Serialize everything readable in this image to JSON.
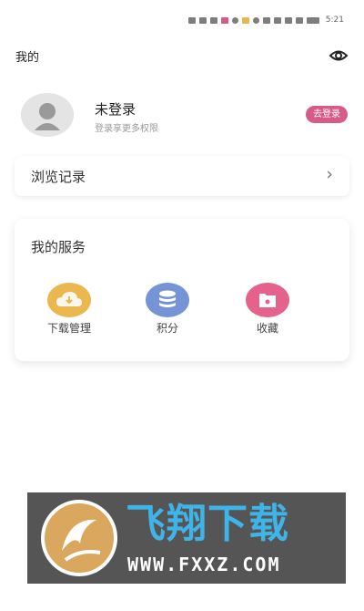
{
  "status_bar": {
    "time": "5:21"
  },
  "header": {
    "title": "我的",
    "visibility_icon": "eye-icon"
  },
  "profile": {
    "username": "未登录",
    "subtitle": "登录享更多权限",
    "login_button": "去登录",
    "avatar_icon": "user-icon"
  },
  "history": {
    "label": "浏览记录",
    "chevron": "›"
  },
  "services": {
    "title": "我的服务",
    "items": [
      {
        "label": "下载管理",
        "icon": "download-cloud-icon",
        "color": "#eab84f"
      },
      {
        "label": "积分",
        "icon": "points-stack-icon",
        "color": "#7594d6"
      },
      {
        "label": "收藏",
        "icon": "favorites-folder-icon",
        "color": "#e4628c"
      }
    ]
  },
  "watermark": {
    "brand_cn": "飞翔下载",
    "brand_url": "WWW.FXXZ.COM"
  },
  "colors": {
    "accent_pink": "#d85b86",
    "watermark_blue": "#3fb4e8"
  }
}
